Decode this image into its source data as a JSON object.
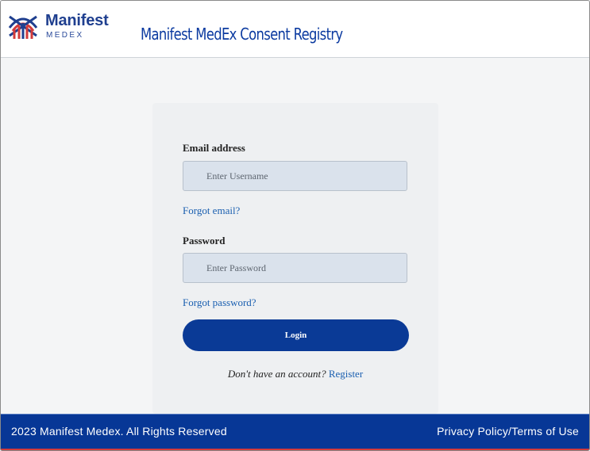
{
  "header": {
    "brand_name": "Manifest",
    "brand_sub": "MEDEX",
    "app_title": "Manifest MedEx Consent Registry",
    "logo_icon": "manifest-medex-logo",
    "colors": {
      "brand_blue": "#1f3f8f",
      "brand_red": "#d23b3b"
    }
  },
  "login_form": {
    "email_label": "Email address",
    "email_placeholder": "Enter Username",
    "email_value": "",
    "forgot_email": "Forgot email?",
    "password_label": "Password",
    "password_placeholder": "Enter Password",
    "password_value": "",
    "forgot_password": "Forgot password?",
    "login_button": "Login",
    "no_account_text": "Don't have an account?",
    "register_link": "Register"
  },
  "footer": {
    "copyright": "2023 Manifest Medex. All Rights Reserved",
    "policy_link": "Privacy Policy/Terms of Use",
    "color": "#073796"
  }
}
